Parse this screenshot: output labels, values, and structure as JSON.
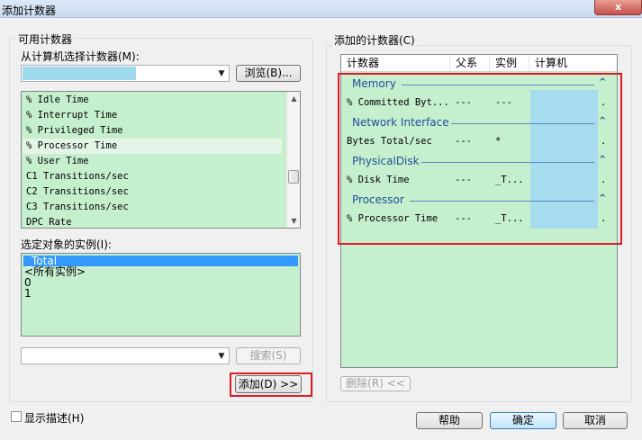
{
  "window": {
    "title": "添加计数器",
    "close_label": "x"
  },
  "available": {
    "group_label": "可用计数器",
    "computer_label": "从计算机选择计数器(M):",
    "browse_label": "浏览(B)...",
    "counters": [
      "% Idle Time",
      "% Interrupt Time",
      "% Privileged Time",
      "% Processor Time",
      "% User Time",
      "C1 Transitions/sec",
      "C2 Transitions/sec",
      "C3 Transitions/sec",
      "DPC Rate"
    ],
    "selected_counter_index": 3,
    "instances_label": "选定对象的实例(I):",
    "instances": [
      "_Total",
      "<所有实例>",
      "0",
      "1"
    ],
    "search_label": "搜索(S)",
    "add_label": "添加(D) >>"
  },
  "added": {
    "group_label": "添加的计数器(C)",
    "headers": {
      "counter": "计数器",
      "parent": "父系",
      "instance": "实例",
      "computer": "计算机"
    },
    "groups": [
      {
        "name": "Memory",
        "counter": "% Committed Byt...",
        "parent": "---",
        "instance": "---",
        "trail": "."
      },
      {
        "name": "Network Interface",
        "counter": "Bytes Total/sec",
        "parent": "---",
        "instance": "*",
        "trail": "."
      },
      {
        "name": "PhysicalDisk",
        "counter": "% Disk Time",
        "parent": "---",
        "instance": "_T...",
        "trail": "."
      },
      {
        "name": "Processor",
        "counter": "% Processor Time",
        "parent": "---",
        "instance": "_T...",
        "trail": "."
      }
    ],
    "chevron": "^",
    "delete_label": "删除(R) <<"
  },
  "footer": {
    "show_desc_label": "显示描述(H)",
    "help_label": "帮助",
    "ok_label": "确定",
    "cancel_label": "取消"
  },
  "colors": {
    "list_bg": "#c6efce",
    "highlight": "#a5dcee",
    "accent_red": "#e01a22",
    "category_text": "#1e4e9a"
  }
}
